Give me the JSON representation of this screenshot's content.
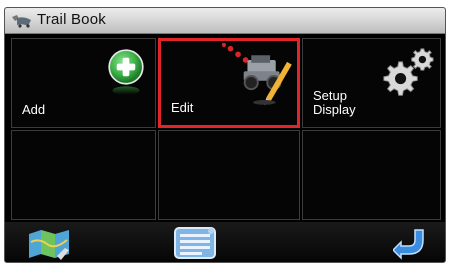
{
  "window": {
    "title": "Trail Book",
    "title_icon": "trail-book-app-icon"
  },
  "tiles": [
    {
      "label": "Add",
      "icon": "add-plus-icon",
      "selected": false
    },
    {
      "label": "Edit",
      "icon": "edit-jeep-pencil-icon",
      "selected": true
    },
    {
      "label": "Setup\nDisplay",
      "icon": "gears-icon",
      "selected": false
    },
    {
      "label": "",
      "icon": "",
      "selected": false
    },
    {
      "label": "",
      "icon": "",
      "selected": false
    },
    {
      "label": "",
      "icon": "",
      "selected": false
    }
  ],
  "bottom_bar": {
    "left_icon": "map-icon",
    "center_icon": "list-menu-icon",
    "right_icon": "back-arrow-icon"
  },
  "colors": {
    "selection": "#e0262b",
    "background": "#000000",
    "plus_green": "#3fb54a"
  }
}
